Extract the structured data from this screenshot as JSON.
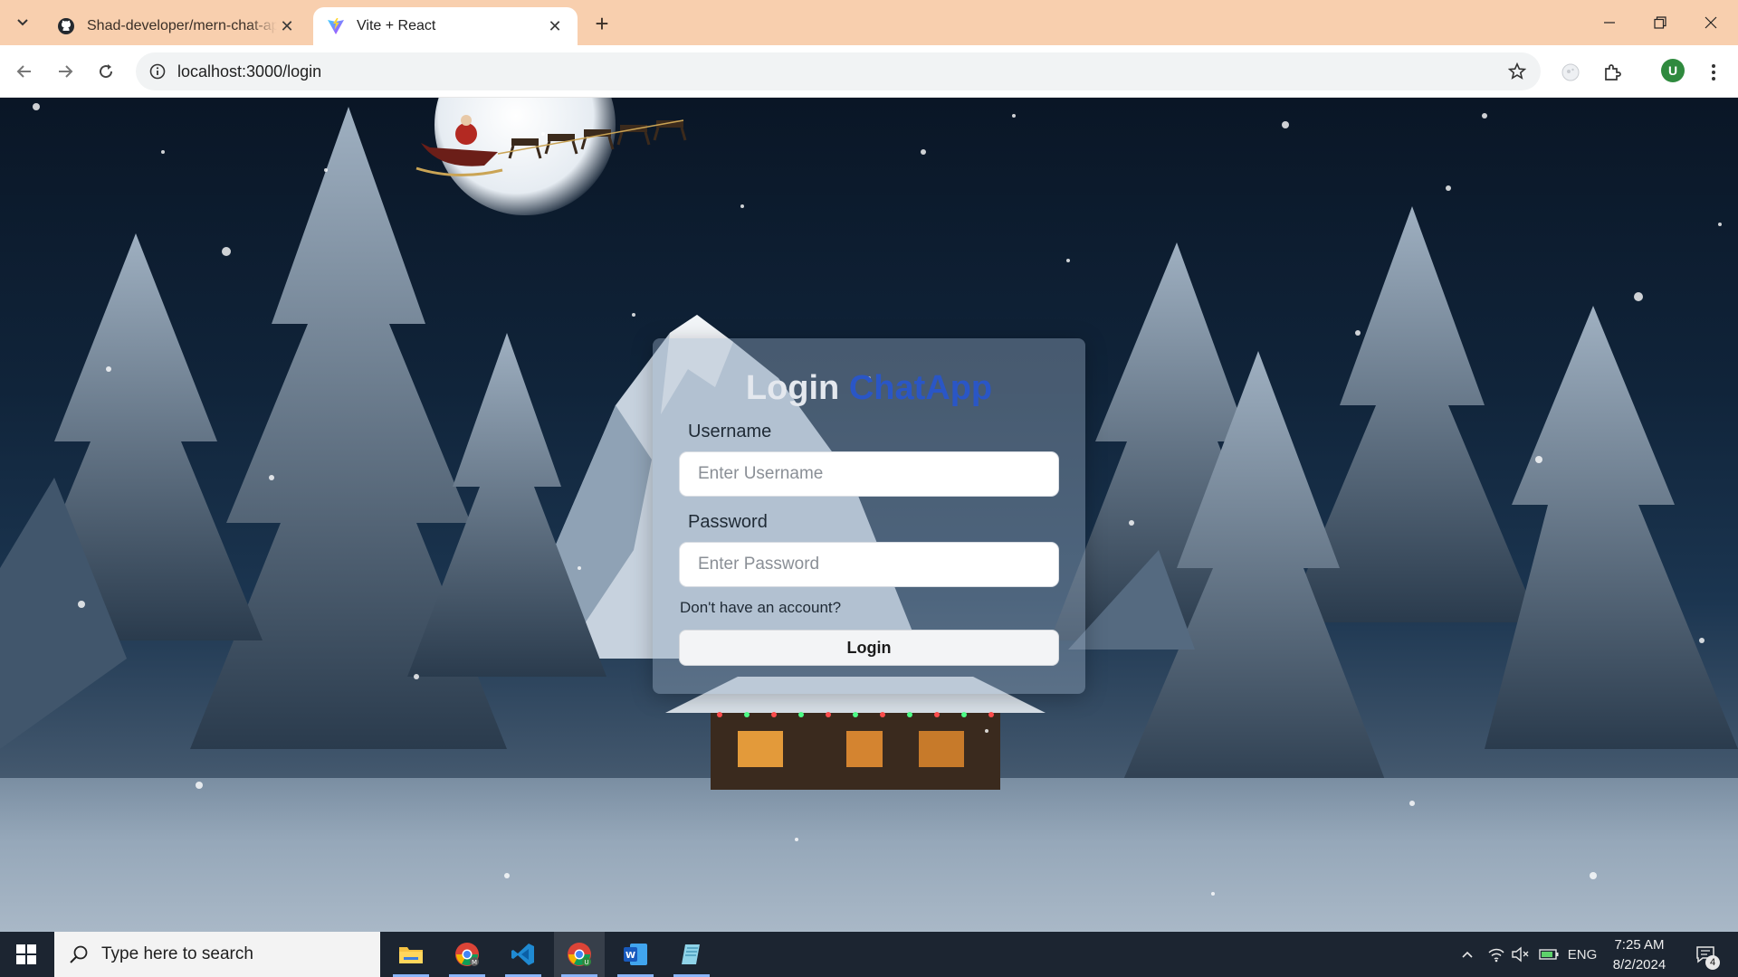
{
  "browser": {
    "tabs": [
      {
        "title": "Shad-developer/mern-chat-app",
        "icon": "github-icon",
        "active": false
      },
      {
        "title": "Vite + React",
        "icon": "vite-icon",
        "active": true
      }
    ],
    "address_url": "localhost:3000/login",
    "profile_initial": "U",
    "accent_color": "#f8cfae"
  },
  "login": {
    "title_prefix": "Login",
    "title_brand": "ChatApp",
    "username_label": "Username",
    "username_placeholder": "Enter Username",
    "password_label": "Password",
    "password_placeholder": "Enter Password",
    "signup_link": "Don't have an account?",
    "submit_label": "Login",
    "brand_color": "#2a56c6"
  },
  "taskbar": {
    "search_placeholder": "Type here to search",
    "apps": [
      "file-explorer-icon",
      "chrome-profile-m-icon",
      "vscode-icon",
      "chrome-profile-u-icon",
      "word-icon",
      "notepad-icon"
    ],
    "language": "ENG",
    "time": "7:25 AM",
    "date": "8/2/2024",
    "notification_count": "4"
  }
}
